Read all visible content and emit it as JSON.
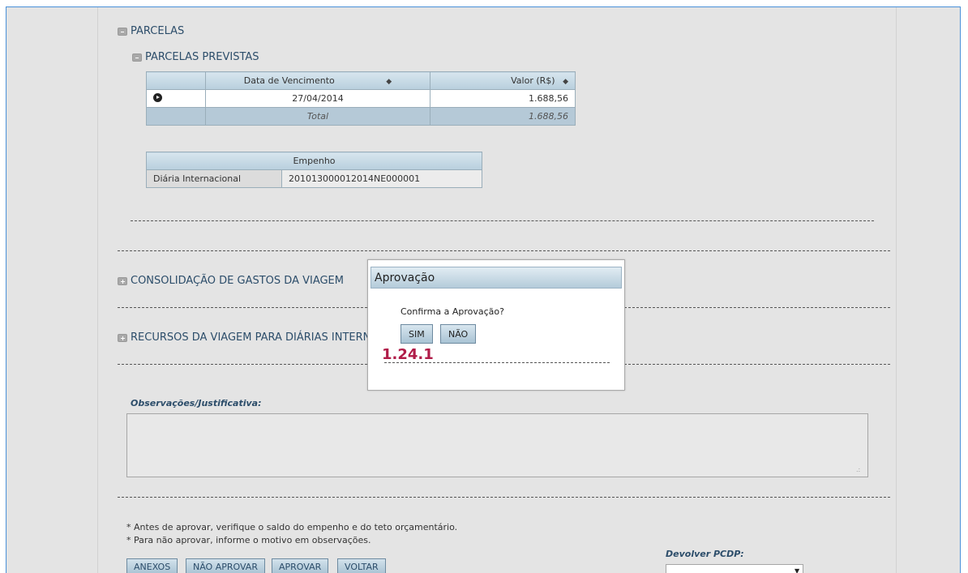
{
  "sections": {
    "parcelas": "PARCELAS",
    "parcelas_previstas": "PARCELAS PREVISTAS",
    "consolidacao": "CONSOLIDAÇÃO DE GASTOS DA VIAGEM",
    "recursos": "RECURSOS DA VIAGEM PARA DIÁRIAS INTERN"
  },
  "parcelas_table": {
    "headers": {
      "data": "Data de Vencimento",
      "valor": "Valor (R$)"
    },
    "rows": [
      {
        "data": "27/04/2014",
        "valor": "1.688,56"
      }
    ],
    "total_label": "Total",
    "total_value": "1.688,56"
  },
  "empenho_table": {
    "header": "Empenho",
    "rows": [
      {
        "tipo": "Diária Internacional",
        "numero": "201013000012014NE000001"
      }
    ]
  },
  "observacoes": {
    "label": "Observações/Justificativa:",
    "value": ""
  },
  "notes": [
    "* Antes de aprovar, verifique o saldo do empenho e do teto orçamentário.",
    "* Para não aprovar, informe o motivo em observações."
  ],
  "buttons": {
    "anexos": "ANEXOS",
    "nao_aprovar": "NÃO APROVAR",
    "aprovar": "APROVAR",
    "voltar": "VOLTAR"
  },
  "devolver": {
    "label": "Devolver PCDP:",
    "selected": ""
  },
  "modal": {
    "title": "Aprovação",
    "message": "Confirma a Aprovação?",
    "yes": "SIM",
    "no": "NÃO",
    "version": "1.24.1"
  },
  "icons": {
    "toggle_minus": "minus-icon",
    "toggle_plus": "plus-icon",
    "sort": "sort-icon",
    "row_expand": "play-circle-icon",
    "select_arrow": "chevron-down-icon"
  },
  "colors": {
    "frame_border": "#4a90d9",
    "section_text": "#2c4d6a",
    "version_text": "#b01c48",
    "header_blue": "#b8cfdd"
  }
}
